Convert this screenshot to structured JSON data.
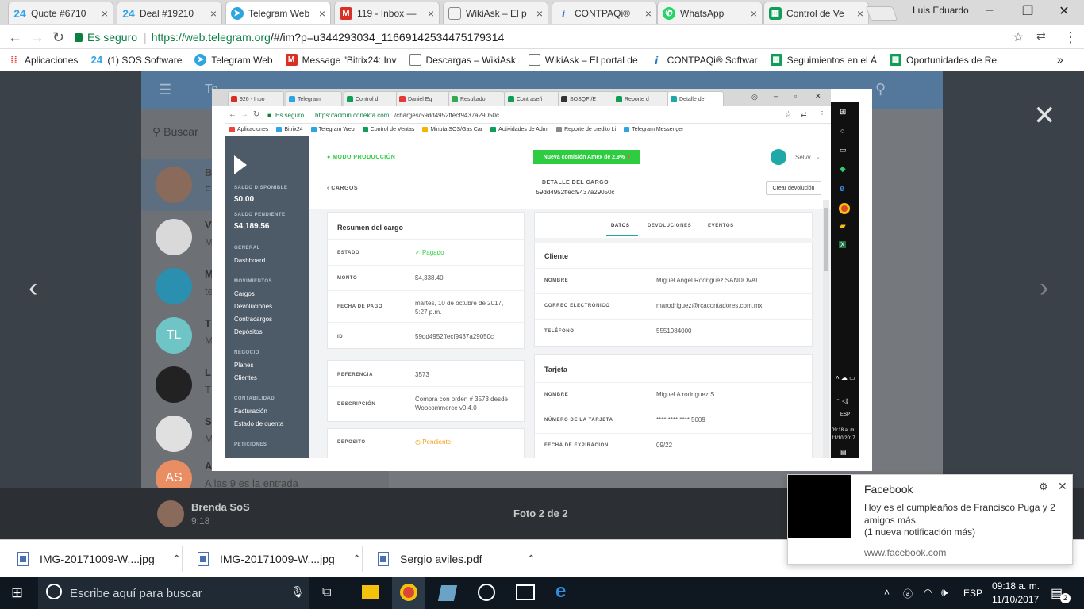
{
  "browser": {
    "tabs": [
      {
        "title": "Quote #6710",
        "icon": "bitrix24-icon",
        "color": "#2fa4e7",
        "glyph": "24"
      },
      {
        "title": "Deal #19210",
        "icon": "bitrix24-icon",
        "color": "#2fa4e7",
        "glyph": "24"
      },
      {
        "title": "Telegram Web",
        "icon": "telegram-icon",
        "color": "#2ca5e0",
        "glyph": "➤",
        "active": true
      },
      {
        "title": "119 - Inbox — ",
        "icon": "gmail-icon",
        "color": "#d93025",
        "glyph": "M"
      },
      {
        "title": "WikiAsk – El p",
        "icon": "document-icon",
        "color": "#888888",
        "glyph": ""
      },
      {
        "title": "CONTPAQi® ",
        "icon": "contpaqi-icon",
        "color": "#1a73c8",
        "glyph": "i"
      },
      {
        "title": "WhatsApp",
        "icon": "whatsapp-icon",
        "color": "#25d366",
        "glyph": "✆"
      },
      {
        "title": "Control de Ve",
        "icon": "sheets-icon",
        "color": "#0f9d58",
        "glyph": "▦"
      }
    ],
    "profile_name": "Luis Eduardo",
    "secure_label": "Es seguro",
    "url_host": "https://web.telegram.org",
    "url_path": "/#/im?p=u344293034_11669142534475179314",
    "bookmarks": [
      {
        "label": "Aplicaciones",
        "icon": "apps-grid-icon",
        "color": "#e8453c"
      },
      {
        "label": "(1) SOS Software",
        "icon": "bitrix24-icon",
        "color": "#2fa4e7"
      },
      {
        "label": "Telegram Web",
        "icon": "telegram-icon",
        "color": "#2ca5e0"
      },
      {
        "label": "Message \"Bitrix24: Inv",
        "icon": "gmail-icon",
        "color": "#d93025"
      },
      {
        "label": "Descargas – WikiAsk",
        "icon": "document-icon",
        "color": "#888888"
      },
      {
        "label": "WikiAsk – El portal de",
        "icon": "document-icon",
        "color": "#888888"
      },
      {
        "label": "CONTPAQi® Softwar",
        "icon": "contpaqi-icon",
        "color": "#1a73c8"
      },
      {
        "label": "Seguimientos en el Á",
        "icon": "sheets-icon",
        "color": "#0f9d58"
      },
      {
        "label": "Oportunidades de Re",
        "icon": "sheets-icon",
        "color": "#0f9d58"
      }
    ]
  },
  "telegram": {
    "search_placeholder": "Buscar",
    "chat_title_fragment": "Te",
    "chats": [
      {
        "initials": "",
        "name": "B",
        "preview": "F",
        "color": "#8a6a5a"
      },
      {
        "initials": "",
        "name": "V",
        "preview": "M",
        "color": "#d9d9d9"
      },
      {
        "initials": "",
        "name": "M",
        "preview": "te",
        "color": "#2b8fb0"
      },
      {
        "initials": "TL",
        "name": "T",
        "preview": "M",
        "color": "#6fc5c6"
      },
      {
        "initials": "",
        "name": "L",
        "preview": "T",
        "color": "#222222"
      },
      {
        "initials": "",
        "name": "S",
        "preview": "M",
        "color": "#e0e0e0"
      },
      {
        "initials": "AS",
        "name": "A",
        "preview": "A las 9 es la entrada",
        "color": "#e98d62"
      }
    ],
    "viewer": {
      "sender": "Brenda SoS",
      "time": "9:18",
      "counter": "Foto 2 de 2"
    }
  },
  "photo": {
    "tabs": [
      {
        "title": "926 - Inbo",
        "color": "#d93025"
      },
      {
        "title": "Telegram",
        "color": "#2ca5e0"
      },
      {
        "title": "Control d",
        "color": "#0f9d58"
      },
      {
        "title": "Daniel Eq",
        "color": "#e53935"
      },
      {
        "title": "Resultado",
        "color": "#34a853"
      },
      {
        "title": "Contraseñ",
        "color": "#0f9d58"
      },
      {
        "title": "SOSQFI/E",
        "color": "#333333"
      },
      {
        "title": "Reporte d",
        "color": "#0f9d58"
      },
      {
        "title": "Detalle de",
        "color": "#1fa8a8",
        "active": true
      }
    ],
    "secure_label": "Es seguro",
    "url_host": "https://admin.conekta.com",
    "url_path": "/charges/59dd4952ffecf9437a29050c",
    "bookmarks": [
      {
        "label": "Aplicaciones",
        "color": "#e8453c"
      },
      {
        "label": "Bitrix24",
        "color": "#2fa4e7"
      },
      {
        "label": "Telegram Web",
        "color": "#2ca5e0"
      },
      {
        "label": "Control de Ventas",
        "color": "#0f9d58"
      },
      {
        "label": "Minuta SOS/Gas Car",
        "color": "#f4b400"
      },
      {
        "label": "Actividades de Admi",
        "color": "#0f9d58"
      },
      {
        "label": "Reporte de credito Li",
        "color": "#888888"
      },
      {
        "label": "Telegram Messenger",
        "color": "#2ca5e0"
      }
    ],
    "sidebar": {
      "saldo_disponible_label": "SALDO DISPONIBLE",
      "saldo_disponible": "$0.00",
      "saldo_pendiente_label": "SALDO PENDIENTE",
      "saldo_pendiente": "$4,189.56",
      "general_label": "GENERAL",
      "dashboard": "Dashboard",
      "movimientos_label": "MOVIMIENTOS",
      "cargos": "Cargos",
      "devoluciones": "Devoluciones",
      "contracargos": "Contracargos",
      "depositos": "Depósitos",
      "negocio_label": "NEGOCIO",
      "planes": "Planes",
      "clientes": "Clientes",
      "contabilidad_label": "CONTABILIDAD",
      "facturacion": "Facturación",
      "estado_cuenta": "Estado de cuenta",
      "peticiones_label": "PETICIONES"
    },
    "header": {
      "mode": "MODO PRODUCCIÓN",
      "promo": "Nueva comisión Amex de 2.9%",
      "user": "Selvv",
      "back": "CARGOS",
      "detail_title": "DETALLE DEL CARGO",
      "charge_id": "59dd4952ffecf9437a29050c",
      "refund_button": "Crear devolución"
    },
    "summary": {
      "title": "Resumen del cargo",
      "estado_label": "ESTADO",
      "estado": "Pagado",
      "monto_label": "MONTO",
      "monto": "$4,338.40",
      "fecha_label": "FECHA DE PAGO",
      "fecha_line1": "martes, 10 de octubre de 2017,",
      "fecha_line2": "5:27 p.m.",
      "id_label": "ID",
      "id": "59dd4952ffecf9437a29050c",
      "referencia_label": "REFERENCIA",
      "referencia": "3573",
      "descripcion_label": "DESCRIPCIÓN",
      "descripcion_line1": "Compra con orden # 3573 desde",
      "descripcion_line2": "Woocommerce v0.4.0",
      "deposito_label": "DEPÓSITO",
      "deposito": "Pendiente"
    },
    "tabs_panel": {
      "datos": "DATOS",
      "devoluciones": "DEVOLUCIONES",
      "eventos": "EVENTOS"
    },
    "cliente": {
      "title": "Cliente",
      "nombre_label": "NOMBRE",
      "nombre": "Miguel Angel Rodriguez SANDOVAL",
      "correo_label": "CORREO ELECTRÓNICO",
      "correo": "marodriguez@rcacontadores.com.mx",
      "telefono_label": "TELÉFONO",
      "telefono": "5551984000"
    },
    "tarjeta": {
      "title": "Tarjeta",
      "nombre_label": "NOMBRE",
      "nombre": "Miguel A rodriguez S",
      "numero_label": "NÚMERO DE LA TARJETA",
      "numero": "**** **** **** 5009",
      "expiracion_label": "FECHA DE EXPIRACIÓN",
      "expiracion": "09/22"
    },
    "mini_taskbar": {
      "time": "09:18 a. m.",
      "date": "11/10/2017",
      "lang": "ESP"
    }
  },
  "downloads": [
    {
      "name": "IMG-20171009-W....jpg"
    },
    {
      "name": "IMG-20171009-W....jpg"
    },
    {
      "name": "Sergio aviles.pdf"
    }
  ],
  "notification": {
    "app": "Facebook",
    "message": "Hoy es el cumpleaños de Francisco Puga y 2 amigos más.",
    "more": "(1 nueva notificación más)",
    "source": "www.facebook.com"
  },
  "taskbar": {
    "search_placeholder": "Escribe aquí para buscar",
    "lang": "ESP",
    "time": "09:18 a. m.",
    "date": "11/10/2017",
    "notif_count": "2"
  },
  "colors": {
    "telegram_header": "#54789b",
    "conekta_sidebar": "#4d5b69",
    "promo_green": "#2ecc40",
    "secure_green": "#0b8043"
  }
}
